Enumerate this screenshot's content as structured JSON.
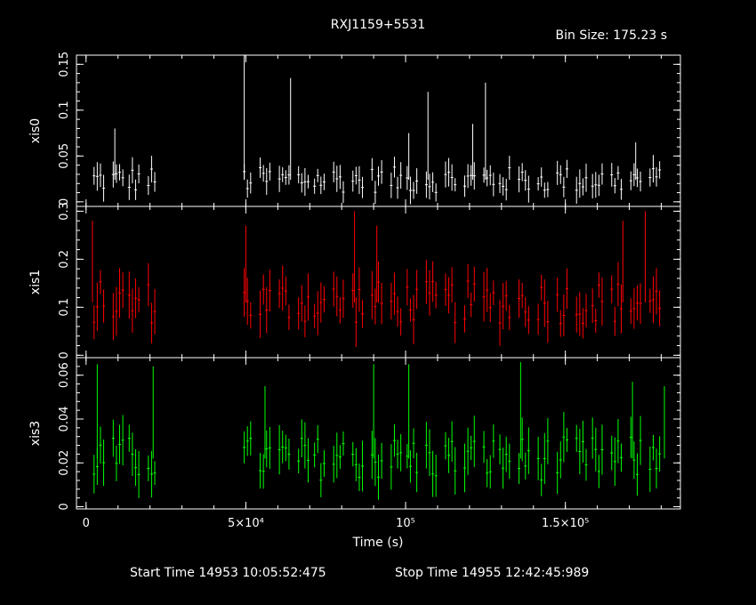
{
  "chart_data": {
    "type": "scatter",
    "title": "RXJ1159+5531",
    "bin_size_label": "Bin Size: 175.23 s",
    "xlabel": "Time (s)",
    "xlim": [
      -3000,
      186000
    ],
    "x_ticks": [
      {
        "v": 0,
        "label": "0"
      },
      {
        "v": 50000,
        "label": "5×10⁴"
      },
      {
        "v": 100000,
        "label": "10⁵"
      },
      {
        "v": 150000,
        "label": "1.5×10⁵"
      }
    ],
    "gap": [
      22000,
      49000
    ],
    "data_range": [
      0,
      182000
    ],
    "panels": [
      {
        "name": "xis0",
        "ylabel": "xis0",
        "color": "#ffffff",
        "ylim": [
          -0.005,
          0.16
        ],
        "y_ticks": [
          {
            "v": 0,
            "label": "0"
          },
          {
            "v": 0.05,
            "label": "0.05"
          },
          {
            "v": 0.1,
            "label": "0.1"
          },
          {
            "v": 0.15,
            "label": "0.15"
          }
        ],
        "mean": 0.024,
        "spread": 0.014,
        "err": 0.012,
        "spikes": [
          [
            9000,
            0.08
          ],
          [
            49500,
            0.16
          ],
          [
            64000,
            0.135
          ],
          [
            101000,
            0.075
          ],
          [
            107000,
            0.12
          ],
          [
            121000,
            0.085
          ],
          [
            125000,
            0.13
          ],
          [
            172000,
            0.065
          ]
        ]
      },
      {
        "name": "xis1",
        "ylabel": "xis1",
        "color": "#ff0000",
        "ylim": [
          -0.005,
          0.31
        ],
        "y_ticks": [
          {
            "v": 0,
            "label": "0"
          },
          {
            "v": 0.1,
            "label": "0.1"
          },
          {
            "v": 0.2,
            "label": "0.2"
          },
          {
            "v": 0.3,
            "label": "0.3"
          }
        ],
        "mean": 0.11,
        "spread": 0.045,
        "err": 0.04,
        "spikes": [
          [
            2000,
            0.28
          ],
          [
            50000,
            0.27
          ],
          [
            84000,
            0.3
          ],
          [
            91000,
            0.27
          ],
          [
            168000,
            0.28
          ],
          [
            175000,
            0.3
          ]
        ]
      },
      {
        "name": "xis3",
        "ylabel": "xis3",
        "color": "#00ff00",
        "ylim": [
          -0.001,
          0.068
        ],
        "y_ticks": [
          {
            "v": 0,
            "label": "0"
          },
          {
            "v": 0.02,
            "label": "0.02"
          },
          {
            "v": 0.04,
            "label": "0.04"
          },
          {
            "v": 0.06,
            "label": "0.06"
          }
        ],
        "mean": 0.022,
        "spread": 0.01,
        "err": 0.009,
        "spikes": [
          [
            3500,
            0.065
          ],
          [
            21000,
            0.064
          ],
          [
            56000,
            0.055
          ],
          [
            90000,
            0.065
          ],
          [
            101000,
            0.065
          ],
          [
            136000,
            0.066
          ],
          [
            171000,
            0.057
          ],
          [
            181000,
            0.055
          ]
        ]
      }
    ]
  },
  "footer": {
    "start": "Start Time 14953 10:05:52:475",
    "stop": "Stop Time 14955 12:42:45:989"
  }
}
